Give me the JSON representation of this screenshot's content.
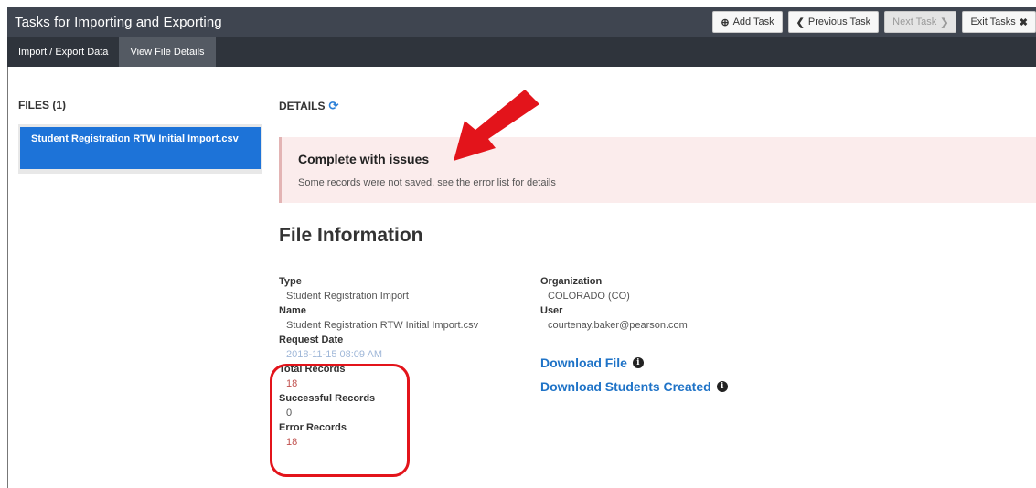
{
  "header": {
    "title": "Tasks for Importing and Exporting",
    "buttons": [
      {
        "label": "Add Task",
        "icon": "plus-circle-icon"
      },
      {
        "label": "Previous Task",
        "icon": "chevron-left-icon"
      },
      {
        "label": "Next Task",
        "icon": "chevron-right-icon"
      },
      {
        "label": "Exit Tasks",
        "icon": "close-icon"
      }
    ]
  },
  "tabs": [
    {
      "label": "Import / Export Data"
    },
    {
      "label": "View File Details"
    }
  ],
  "files": {
    "heading": "FILES (1)",
    "items": [
      {
        "label": "Student Registration RTW Initial Import.csv"
      }
    ]
  },
  "details": {
    "heading": "DETAILS",
    "alert": {
      "title": "Complete with issues",
      "message": "Some records were not saved, see the error list for details"
    },
    "section_title": "File Information",
    "left_fields": [
      {
        "label": "Type",
        "value": "Student Registration Import"
      },
      {
        "label": "Name",
        "value": "Student Registration RTW Initial Import.csv"
      },
      {
        "label": "Request Date",
        "value": "2018-11-15 08:09 AM"
      },
      {
        "label": "Total Records",
        "value": "18"
      },
      {
        "label": "Successful Records",
        "value": "0"
      },
      {
        "label": "Error Records",
        "value": "18"
      }
    ],
    "right_fields": [
      {
        "label": "Organization",
        "value": "COLORADO (CO)"
      },
      {
        "label": "User",
        "value": "courtenay.baker@pearson.com"
      }
    ],
    "links": [
      {
        "label": "Download File"
      },
      {
        "label": "Download Students Created"
      }
    ]
  },
  "colors": {
    "header_bg": "#3f4550",
    "subbar_bg": "#2f343c",
    "selected_file": "#1d73d8",
    "alert_bg": "#fbecec",
    "link": "#1f73c7",
    "annotation": "#e3141b"
  }
}
